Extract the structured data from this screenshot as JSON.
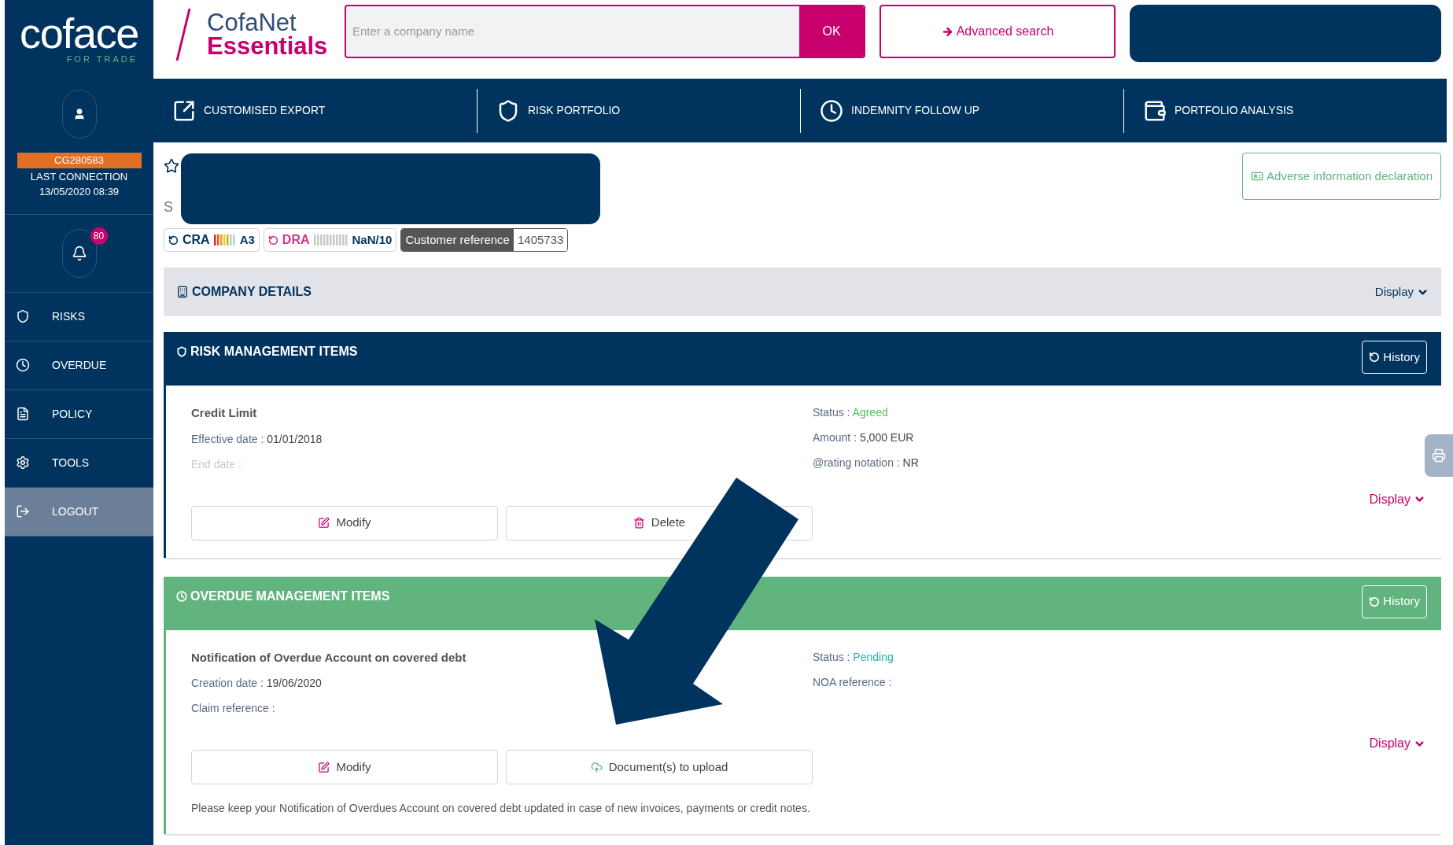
{
  "brand": {
    "logo": "coface",
    "tagline": "FOR TRADE",
    "product_top": "CofaNet",
    "product_bottom": "Essentials"
  },
  "search": {
    "placeholder": "Enter a company name",
    "button": "OK"
  },
  "advanced_search": "Advanced search",
  "user": {
    "id": "CG280583",
    "last_connection_label": "LAST CONNECTION",
    "last_connection_time": "13/05/2020 08:39"
  },
  "notifications": {
    "count": "80"
  },
  "sidebar": {
    "items": [
      {
        "label": "RISKS",
        "kind": "shield",
        "selected": false
      },
      {
        "label": "OVERDUE",
        "kind": "clock",
        "selected": false
      },
      {
        "label": "POLICY",
        "kind": "document",
        "selected": false
      },
      {
        "label": "TOOLS",
        "kind": "gear",
        "selected": false
      },
      {
        "label": "LOGOUT",
        "kind": "logout",
        "selected": true
      }
    ]
  },
  "nav": {
    "items": [
      {
        "label": "CUSTOMISED EXPORT",
        "kind": "export"
      },
      {
        "label": "RISK PORTFOLIO",
        "kind": "shield"
      },
      {
        "label": "INDEMNITY FOLLOW UP",
        "kind": "clock"
      },
      {
        "label": "PORTFOLIO ANALYSIS",
        "kind": "wallet"
      }
    ]
  },
  "company": {
    "name_partial": "S",
    "adverse_button": "Adverse information declaration"
  },
  "ratings": [
    {
      "kind": "cra",
      "label": "CRA",
      "grade": "A3"
    },
    {
      "kind": "dra",
      "label": "DRA",
      "grade": "NaN/10"
    }
  ],
  "customer_reference": {
    "label": "Customer reference",
    "value": "1405733"
  },
  "company_details": {
    "title": "COMPANY DETAILS",
    "display": "Display"
  },
  "sections": [
    {
      "kind": "risk",
      "title": "RISK MANAGEMENT ITEMS",
      "history": "History",
      "item_title": "Credit Limit",
      "left_fields": [
        {
          "label": "Effective date :",
          "value": "01/01/2018",
          "disabled": false
        },
        {
          "label": "End date :",
          "disabled": true
        }
      ],
      "status": {
        "label": "Status :",
        "value": "Agreed",
        "color": "#5cb85c"
      },
      "right_fields": [
        {
          "label": "Amount :",
          "value": "5,000 EUR"
        },
        {
          "label": "@rating notation :",
          "value": "NR"
        }
      ],
      "display": "Display",
      "buttons": [
        {
          "label": "Modify",
          "kind": "edit"
        },
        {
          "label": "Delete",
          "kind": "trash"
        }
      ]
    },
    {
      "kind": "overdue",
      "title": "OVERDUE MANAGEMENT ITEMS",
      "history": "History",
      "item_title": "Notification of Overdue Account on covered debt",
      "left_fields": [
        {
          "label": "Creation date :",
          "value": "19/06/2020",
          "disabled": false
        },
        {
          "label": "Claim reference :",
          "disabled": false
        }
      ],
      "status": {
        "label": "Status :",
        "value": "Pending",
        "color": "#1fb3b3"
      },
      "right_fields": [
        {
          "label": "NOA reference :"
        }
      ],
      "display": "Display",
      "buttons": [
        {
          "label": "Modify",
          "kind": "edit"
        },
        {
          "label": "Document(s) to upload",
          "kind": "upload"
        }
      ],
      "note": "Please keep your Notification of Overdues Account on covered debt updated in case of new invoices, payments or credit notes."
    }
  ]
}
